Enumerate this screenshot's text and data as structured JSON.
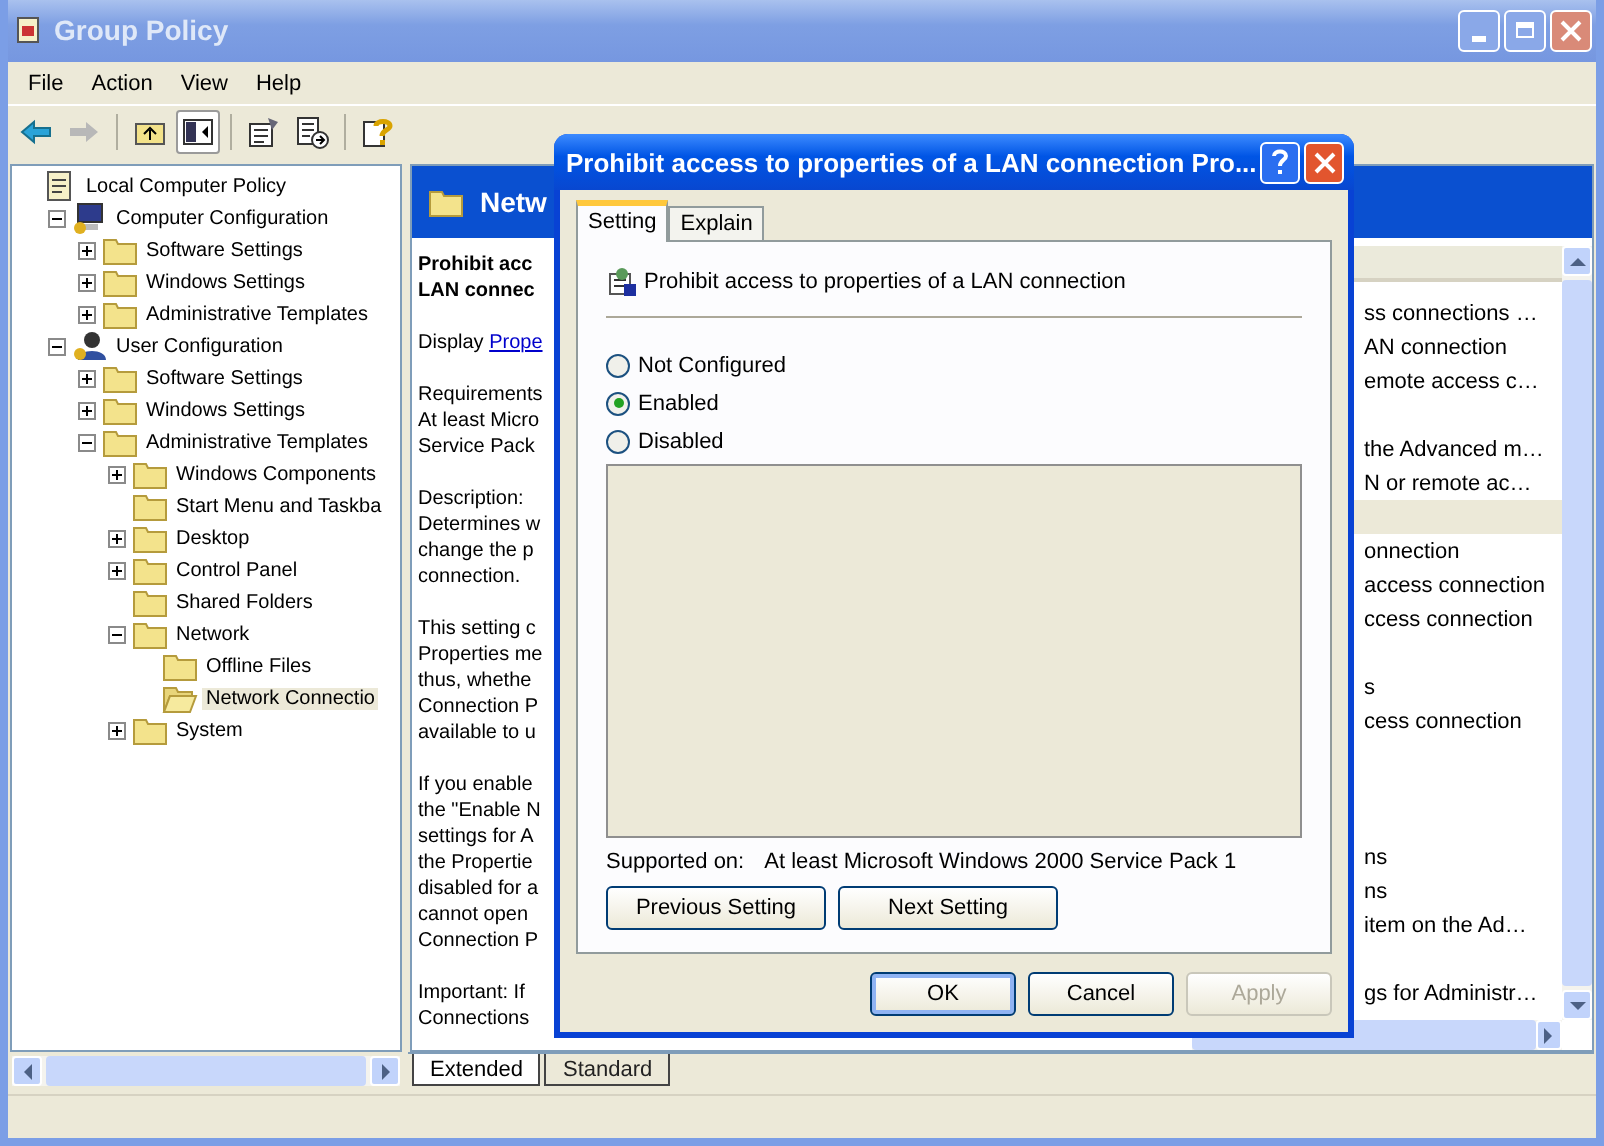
{
  "window": {
    "title": "Group Policy",
    "active": false
  },
  "menu": [
    "File",
    "Action",
    "View",
    "Help"
  ],
  "toolbar": [
    [
      {
        "kind": "back",
        "pressed": false
      },
      {
        "kind": "forward",
        "pressed": false
      }
    ],
    [
      {
        "kind": "up",
        "pressed": false
      },
      {
        "kind": "tree-toggle",
        "pressed": true
      }
    ],
    [
      {
        "kind": "properties",
        "pressed": false
      },
      {
        "kind": "export",
        "pressed": false
      }
    ],
    [
      {
        "kind": "help",
        "pressed": false
      }
    ]
  ],
  "tree": [
    {
      "label": "Local Computer Policy",
      "kind": "policy",
      "selected": false,
      "children": [
        {
          "label": "Computer Configuration",
          "kind": "computer",
          "expanded": true,
          "selected": false,
          "children": [
            {
              "label": "Software Settings",
              "kind": "folder",
              "expanded": false,
              "selected": false
            },
            {
              "label": "Windows Settings",
              "kind": "folder",
              "expanded": false,
              "selected": false
            },
            {
              "label": "Administrative Templates",
              "kind": "folder",
              "expanded": false,
              "selected": false
            }
          ]
        },
        {
          "label": "User Configuration",
          "kind": "user",
          "expanded": true,
          "selected": false,
          "children": [
            {
              "label": "Software Settings",
              "kind": "folder",
              "expanded": false,
              "selected": false
            },
            {
              "label": "Windows Settings",
              "kind": "folder",
              "expanded": false,
              "selected": false
            },
            {
              "label": "Administrative Templates",
              "kind": "folder",
              "expanded": true,
              "selected": false,
              "children": [
                {
                  "label": "Windows Components",
                  "kind": "folder",
                  "expanded": false,
                  "selected": false
                },
                {
                  "label": "Start Menu and Taskba",
                  "kind": "folder",
                  "selected": false
                },
                {
                  "label": "Desktop",
                  "kind": "folder",
                  "expanded": false,
                  "selected": false
                },
                {
                  "label": "Control Panel",
                  "kind": "folder",
                  "expanded": false,
                  "selected": false
                },
                {
                  "label": "Shared Folders",
                  "kind": "folder",
                  "selected": false
                },
                {
                  "label": "Network",
                  "kind": "folder",
                  "expanded": true,
                  "selected": false,
                  "children": [
                    {
                      "label": "Offline Files",
                      "kind": "folder",
                      "selected": false
                    },
                    {
                      "label": "Network Connectio",
                      "kind": "folder-open",
                      "selected": true
                    }
                  ]
                },
                {
                  "label": "System",
                  "kind": "folder",
                  "expanded": false,
                  "selected": false
                }
              ]
            }
          ]
        }
      ]
    }
  ],
  "pane": {
    "header": "Netw",
    "description": [
      {
        "kind": "title",
        "lines": [
          "Prohibit acc",
          "LAN connec"
        ]
      },
      {
        "kind": "link",
        "prefix": "Display",
        "link": "Prope"
      },
      {
        "kind": "text",
        "lines": [
          "Requirements",
          "At least Micro",
          "Service Pack"
        ]
      },
      {
        "kind": "text",
        "lines": [
          "Description:",
          "Determines w",
          "change the p",
          "connection."
        ]
      },
      {
        "kind": "text",
        "lines": [
          "This setting c",
          "Properties me",
          "thus, whethe",
          "Connection P",
          "available to u"
        ]
      },
      {
        "kind": "text",
        "lines": [
          "If you enable",
          "the \"Enable N",
          "settings for A",
          "the Propertie",
          "disabled for a",
          "cannot open",
          "Connection P"
        ]
      },
      {
        "kind": "text",
        "lines": [
          "Important: If",
          "Connections"
        ]
      }
    ],
    "rows": [
      {
        "text": "ss connections …",
        "selected": false
      },
      {
        "text": "AN connection",
        "selected": false
      },
      {
        "text": "emote access c…",
        "selected": false
      },
      {
        "selected": false
      },
      {
        "text": "the Advanced m…",
        "selected": false
      },
      {
        "text": "N or remote ac…",
        "selected": false
      },
      {
        "selected": true
      },
      {
        "text": "onnection",
        "selected": false
      },
      {
        "text": "access connection",
        "selected": false
      },
      {
        "text": "ccess connection",
        "selected": false
      },
      {
        "selected": false
      },
      {
        "text": "s",
        "selected": false
      },
      {
        "text": "cess connection",
        "selected": false
      },
      {
        "selected": false
      },
      {
        "selected": false
      },
      {
        "selected": false
      },
      {
        "text": "ns",
        "selected": false
      },
      {
        "text": "ns",
        "selected": false
      },
      {
        "text": "item on the Ad…",
        "selected": false
      },
      {
        "selected": false
      },
      {
        "text": "gs for Administr…",
        "selected": false
      }
    ]
  },
  "bottom_tabs": [
    {
      "label": "Extended",
      "selected": true
    },
    {
      "label": "Standard",
      "selected": false
    }
  ],
  "dialog": {
    "title": "Prohibit access to properties of a LAN connection Pro...",
    "tabs": [
      {
        "label": "Setting",
        "selected": true
      },
      {
        "label": "Explain",
        "selected": false
      }
    ],
    "policy_name": "Prohibit access to properties of a LAN connection",
    "options": [
      {
        "label": "Not Configured",
        "selected": false
      },
      {
        "label": "Enabled",
        "selected": true
      },
      {
        "label": "Disabled",
        "selected": false
      }
    ],
    "supported_label": "Supported on:",
    "supported_value": "At least Microsoft Windows 2000 Service Pack 1",
    "nav_buttons": [
      "Previous Setting",
      "Next Setting"
    ],
    "buttons": [
      {
        "label": "OK",
        "default": true,
        "disabled": false
      },
      {
        "label": "Cancel",
        "default": false,
        "disabled": false
      },
      {
        "label": "Apply",
        "default": false,
        "disabled": true
      }
    ]
  }
}
